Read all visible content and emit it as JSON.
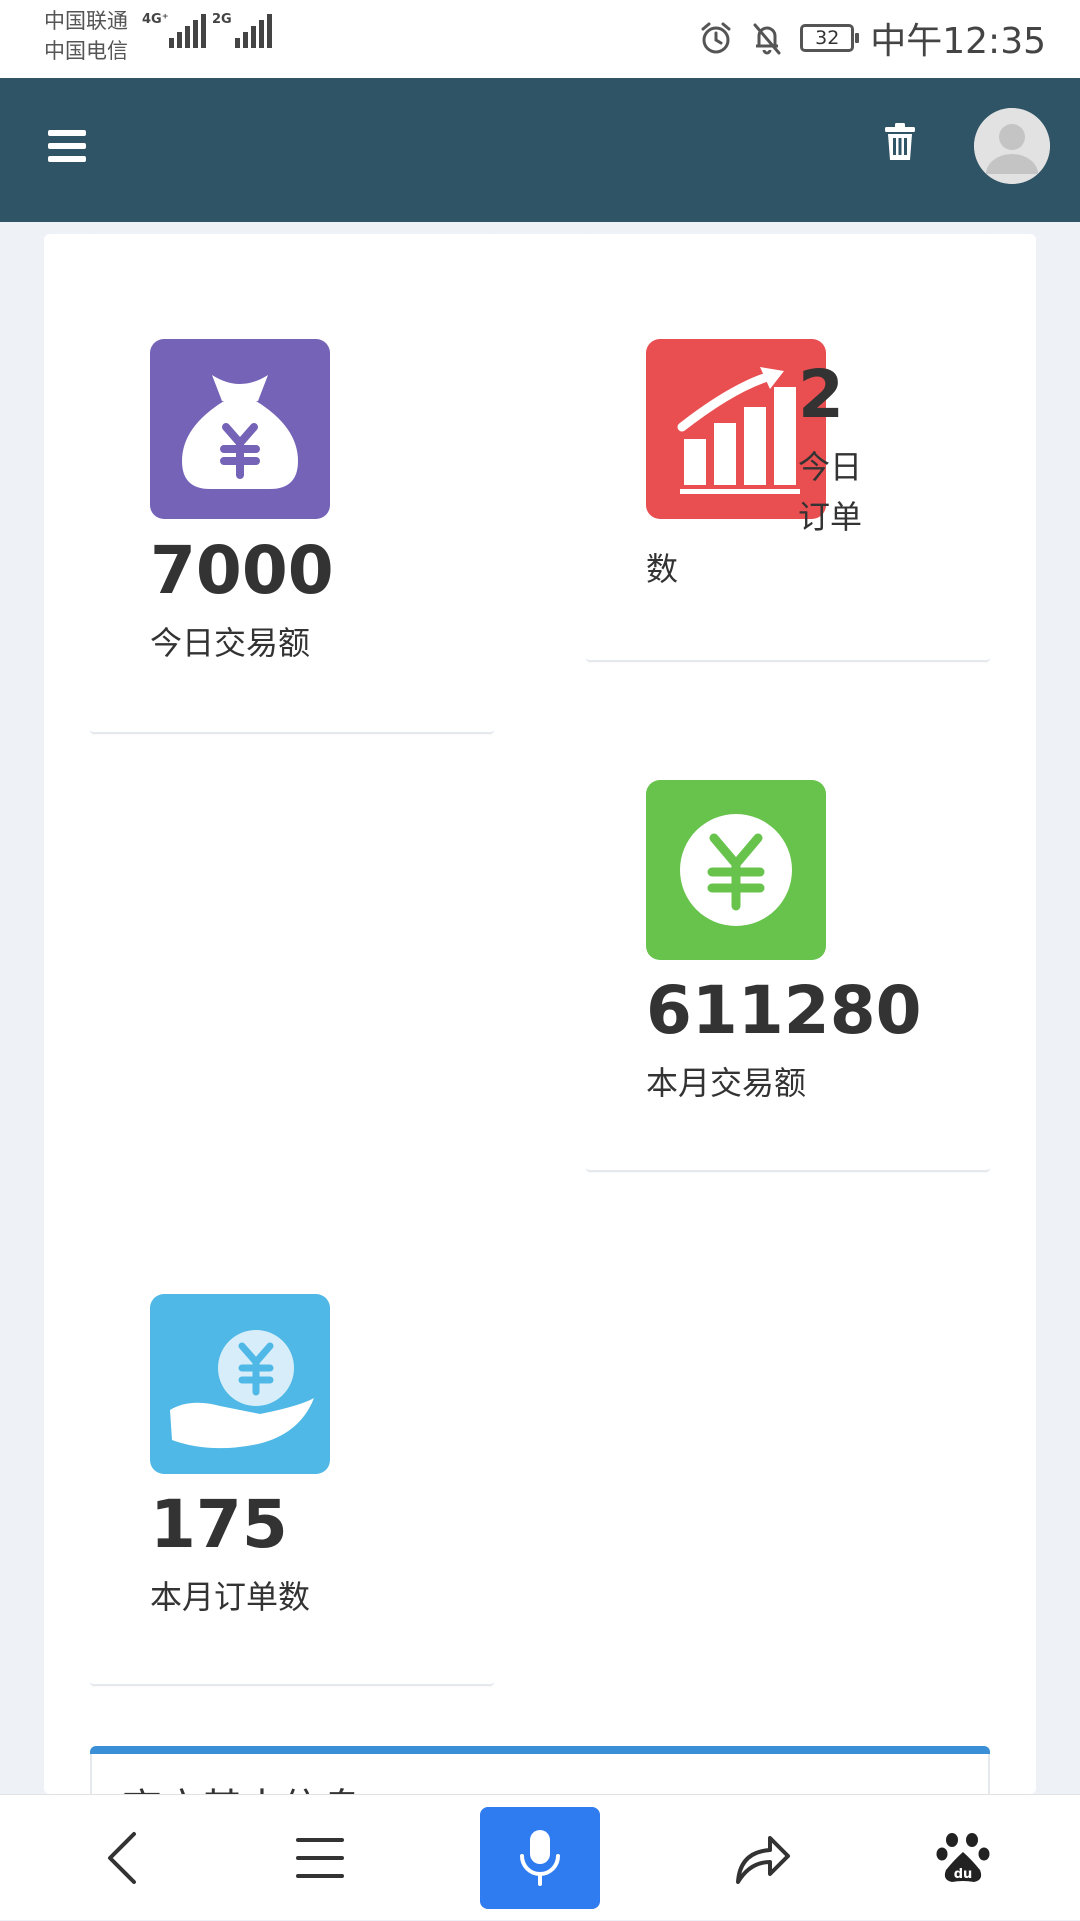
{
  "status_bar": {
    "carrier_1": "中国联通",
    "carrier_2": "中国电信",
    "signal_1_tag": "4G⁺",
    "signal_2_tag": "2G",
    "battery": "32",
    "time": "中午12:35"
  },
  "header": {
    "menu_icon": "menu-icon",
    "trash_icon": "trash-icon",
    "avatar_icon": "user-avatar-icon",
    "color": "#2f5466"
  },
  "stats": [
    {
      "value": "7000",
      "label": "今日交易额",
      "icon": "money-bag-icon",
      "color": "#7563b7"
    },
    {
      "value": "2",
      "label_line1": "今日",
      "label_line2": "订单",
      "label_line3": "数",
      "icon": "growth-chart-icon",
      "color": "#e94f51"
    },
    {
      "value": "611280",
      "label": "本月交易额",
      "icon": "yuan-coin-icon",
      "color": "#67c34c"
    },
    {
      "value": "175",
      "label": "本月订单数",
      "icon": "hand-coin-icon",
      "color": "#4fb8e6"
    }
  ],
  "notice": {
    "title_partial": "商户基本信息",
    "accent_color": "#3b8fd6"
  },
  "bottom_nav": {
    "back_icon": "back-icon",
    "menu_icon": "menu-lines-icon",
    "voice_icon": "microphone-icon",
    "share_icon": "share-icon",
    "baidu_icon": "baidu-paw-icon",
    "voice_color": "#2f7bf0"
  }
}
